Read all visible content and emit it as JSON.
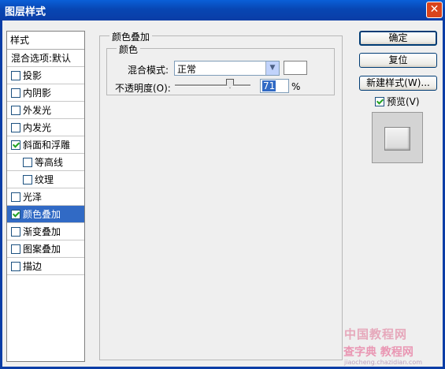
{
  "window": {
    "title": "图层样式",
    "close_glyph": "✕"
  },
  "style_list": {
    "header": "样式",
    "blend_options": "混合选项:默认",
    "items": [
      {
        "label": "投影",
        "checked": false,
        "sub": false,
        "selected": false
      },
      {
        "label": "内阴影",
        "checked": false,
        "sub": false,
        "selected": false
      },
      {
        "label": "外发光",
        "checked": false,
        "sub": false,
        "selected": false
      },
      {
        "label": "内发光",
        "checked": false,
        "sub": false,
        "selected": false
      },
      {
        "label": "斜面和浮雕",
        "checked": true,
        "sub": false,
        "selected": false
      },
      {
        "label": "等高线",
        "checked": false,
        "sub": true,
        "selected": false
      },
      {
        "label": "纹理",
        "checked": false,
        "sub": true,
        "selected": false
      },
      {
        "label": "光泽",
        "checked": false,
        "sub": false,
        "selected": false
      },
      {
        "label": "颜色叠加",
        "checked": true,
        "sub": false,
        "selected": true
      },
      {
        "label": "渐变叠加",
        "checked": false,
        "sub": false,
        "selected": false
      },
      {
        "label": "图案叠加",
        "checked": false,
        "sub": false,
        "selected": false
      },
      {
        "label": "描边",
        "checked": false,
        "sub": false,
        "selected": false
      }
    ]
  },
  "panel": {
    "group_title": "颜色叠加",
    "subgroup_title": "颜色",
    "blend_mode_label": "混合模式:",
    "blend_mode_value": "正常",
    "swatch_color": "#ffffff",
    "opacity_label": "不透明度(O):",
    "opacity_value": "71",
    "opacity_unit": "%"
  },
  "buttons": {
    "ok": "确定",
    "reset": "复位",
    "new_style": "新建样式(W)...",
    "preview_label": "预览(V)",
    "preview_checked": true
  },
  "watermark": {
    "line1": "中国教程网",
    "line2": "查字典 教程网",
    "line3": "jiaocheng.chazidian.com"
  }
}
